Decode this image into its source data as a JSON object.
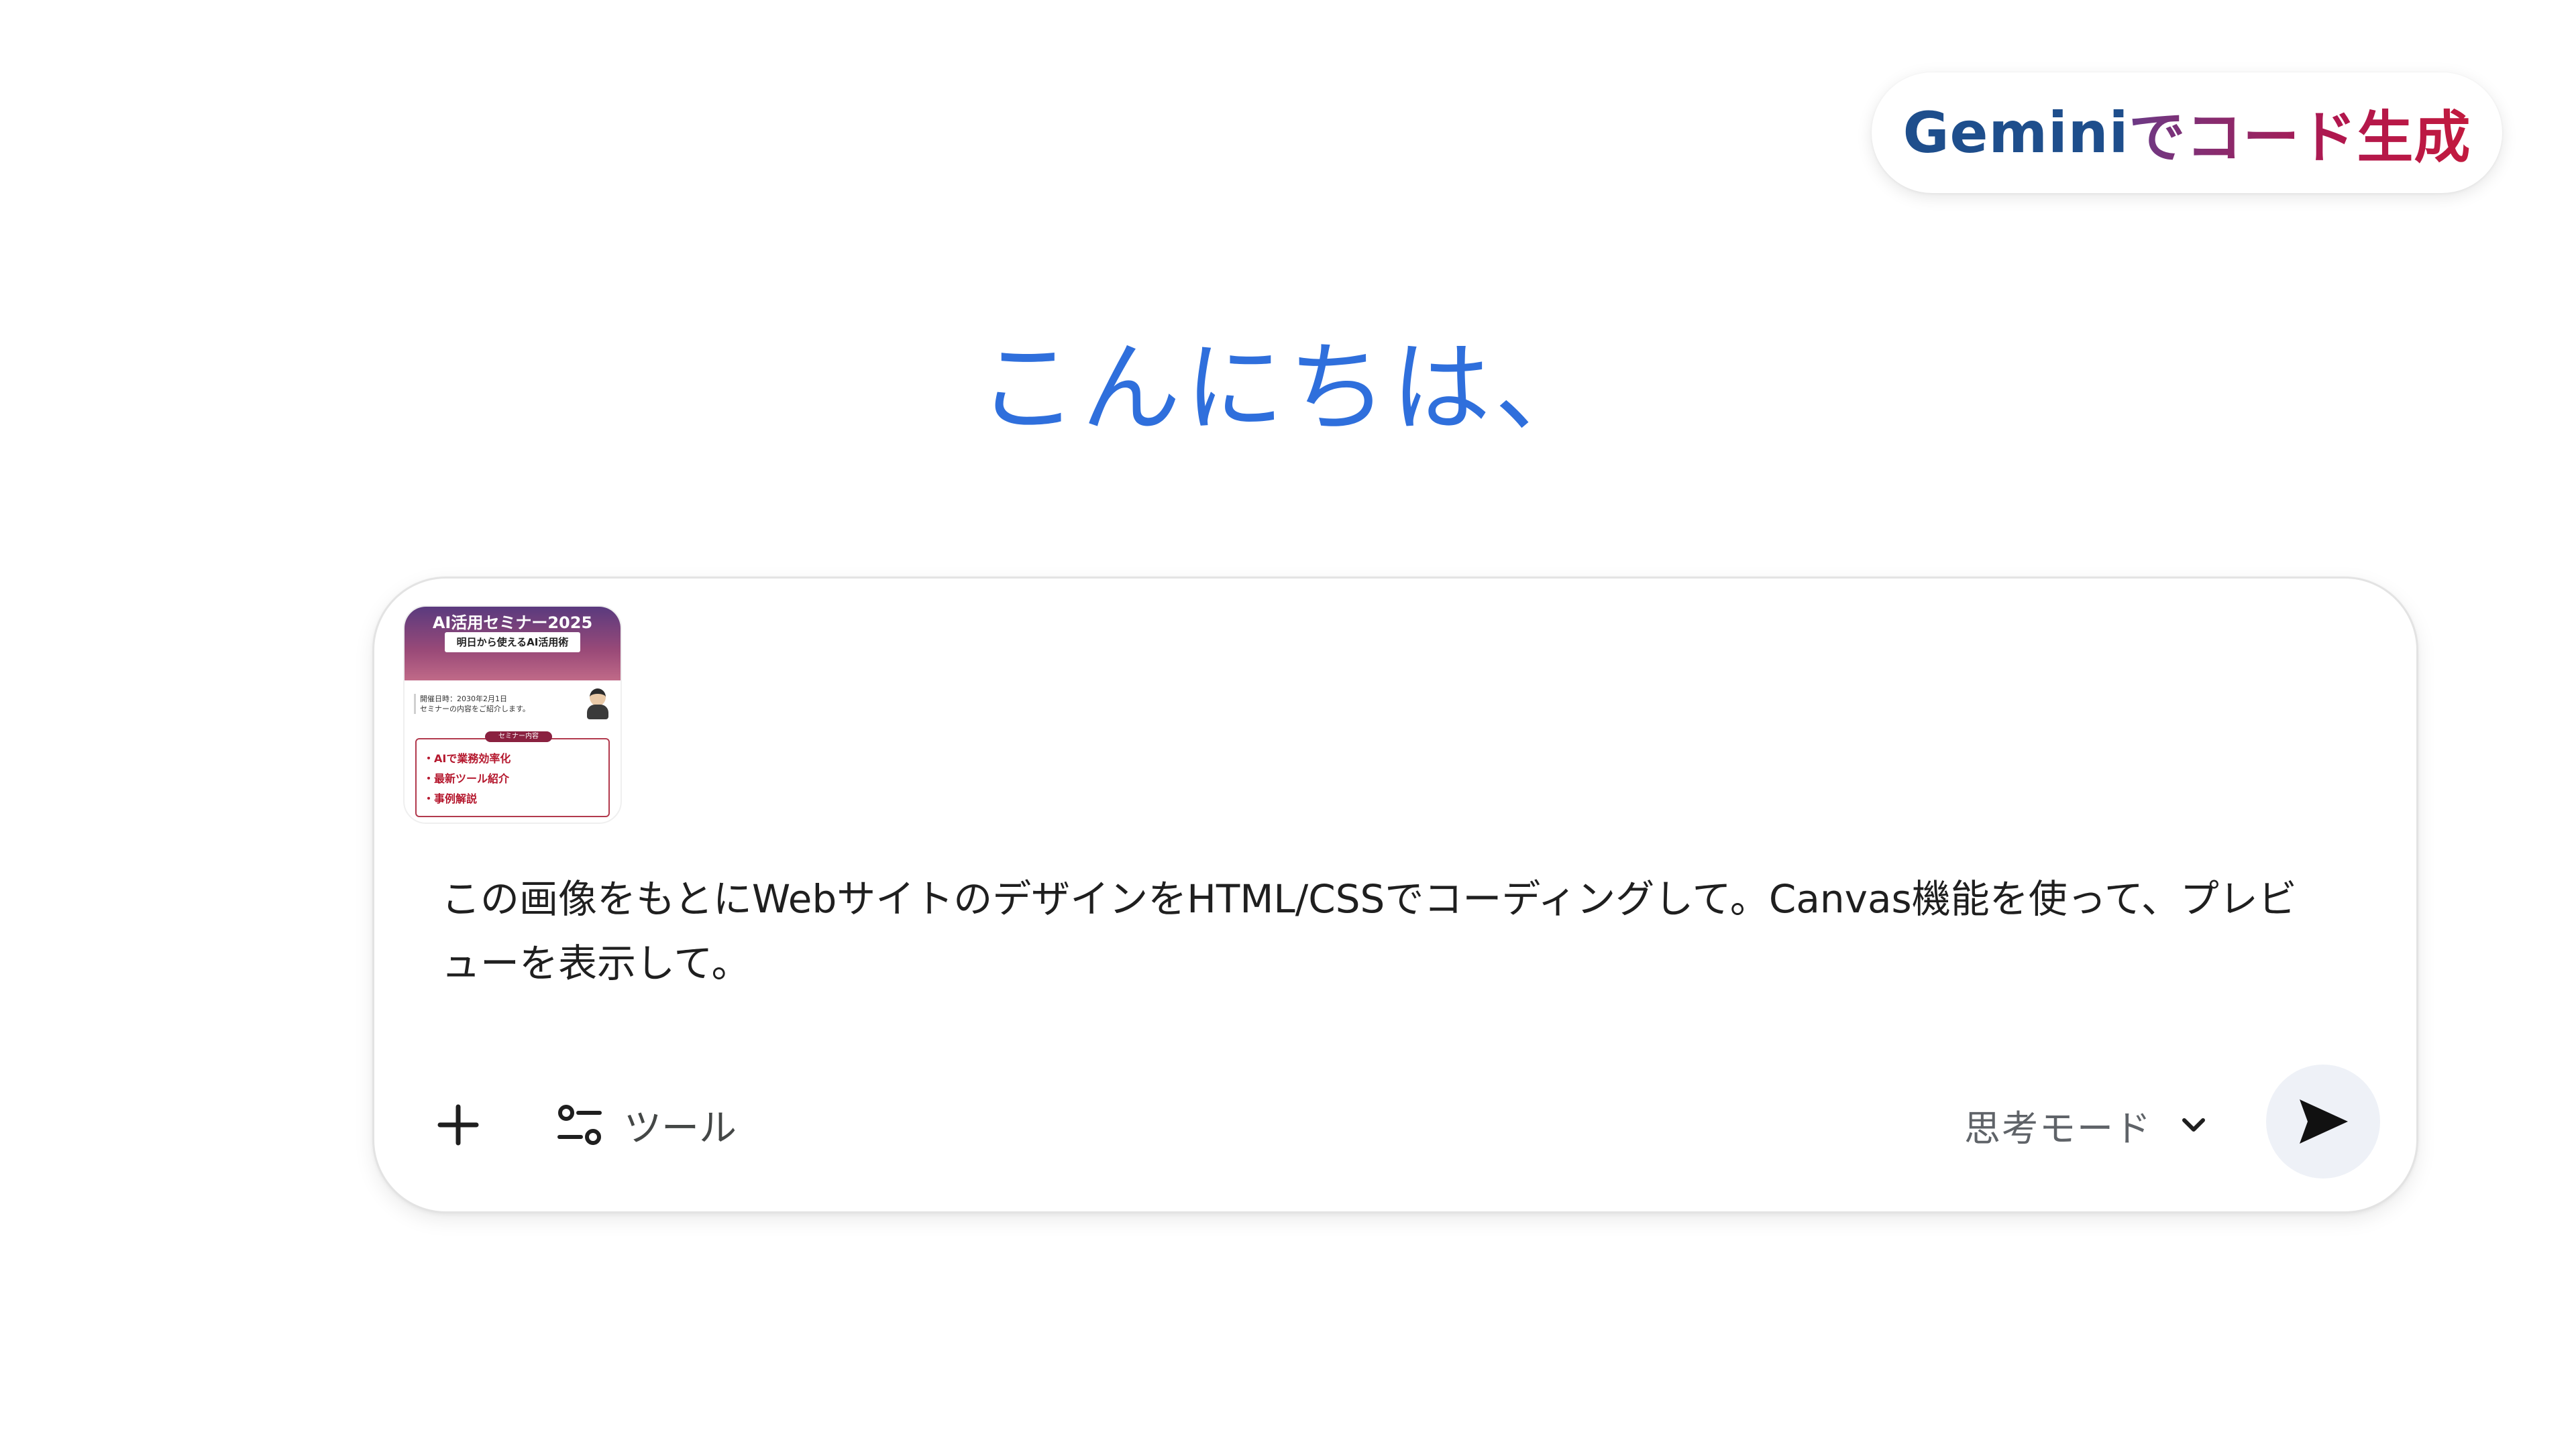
{
  "header": {
    "title_part1": "Gemini",
    "title_part2": "でコード生成"
  },
  "greeting": "こんにちは、",
  "prompt": {
    "attachment": {
      "title": "AI活用セミナー2025",
      "subtitle": "明日から使えるAI活用術",
      "info_line1": "開催日時：2030年2月1日",
      "info_line2": "セミナーの内容をご紹介します。",
      "tag": "セミナー内容",
      "items": [
        "・AIで業務効率化",
        "・最新ツール紹介",
        "・事例解説"
      ]
    },
    "text": "この画像をもとにWebサイトのデザインをHTML/CSSでコーディングして。Canvas機能を使って、プレビューを表示して。"
  },
  "toolbar": {
    "add_icon": "plus-icon",
    "tools_icon": "tools-sliders-icon",
    "tools_label": "ツール",
    "mode_label": "思考モード",
    "mode_icon": "chevron-down-icon",
    "send_icon": "send-arrow-icon"
  },
  "colors": {
    "greeting": "#2f6fdc",
    "title_blue": "#1e4e8c",
    "title_red": "#c21a3e",
    "send_bg": "#eef1f7"
  }
}
